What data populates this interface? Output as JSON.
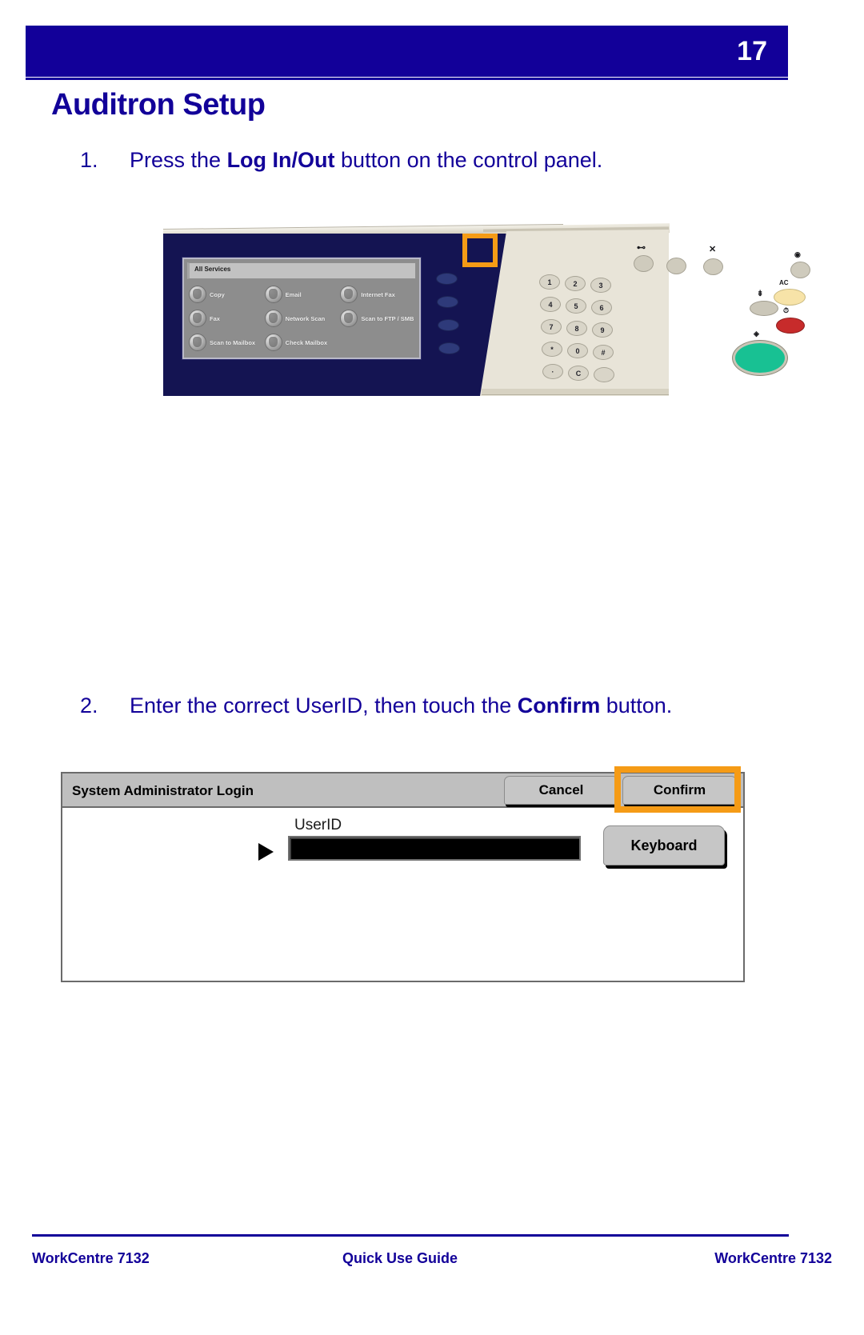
{
  "header": {
    "page_number": "17",
    "title": "Auditron Setup"
  },
  "steps": [
    {
      "number": "1.",
      "text_before": "Press the ",
      "text_bold": "Log In/Out",
      "text_after": " button on the control panel."
    },
    {
      "number": "2.",
      "text_before": "Enter the correct UserID, then touch the ",
      "text_bold": "Confirm",
      "text_after": " button."
    }
  ],
  "control_panel": {
    "touchscreen": {
      "titlebar": "All Services",
      "services": [
        "Copy",
        "Email",
        "Internet Fax",
        "Fax",
        "Network Scan",
        "Scan to FTP / SMB",
        "Scan to Mailbox",
        "Check Mailbox"
      ]
    },
    "keypad": [
      "1",
      "2",
      "3",
      "4",
      "5",
      "6",
      "7",
      "8",
      "9",
      "*",
      "0",
      "#",
      "·",
      "C"
    ],
    "highlight_color": "#F59B16",
    "highlighted_button": "Log In/Out"
  },
  "login_dialog": {
    "title": "System Administrator Login",
    "cancel_label": "Cancel",
    "confirm_label": "Confirm",
    "userid_label": "UserID",
    "userid_value": "",
    "keyboard_label": "Keyboard",
    "highlight_color": "#F59B16"
  },
  "footer": {
    "left": "WorkCentre 7132",
    "center": "Quick Use Guide",
    "right": "WorkCentre 7132"
  }
}
